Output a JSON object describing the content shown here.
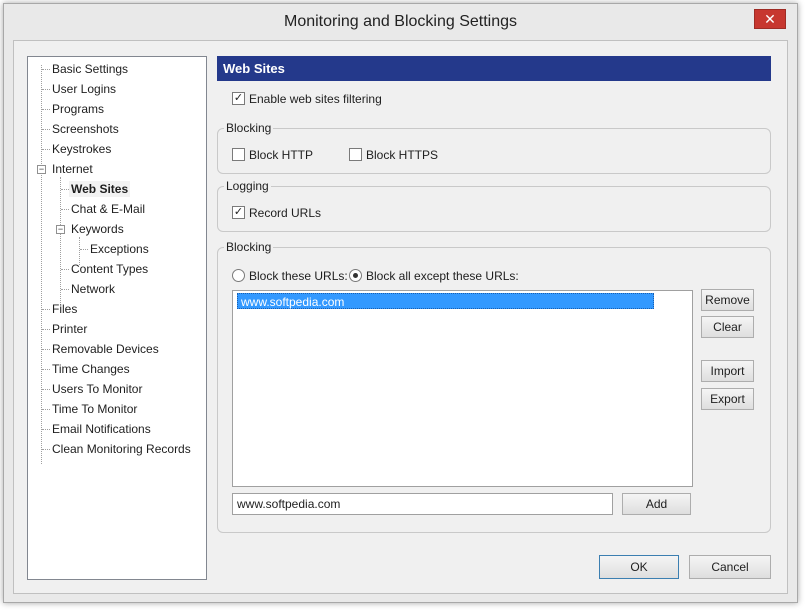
{
  "window": {
    "title": "Monitoring and Blocking Settings",
    "close_glyph": "✕"
  },
  "tree": {
    "items": [
      "Basic Settings",
      "User Logins",
      "Programs",
      "Screenshots",
      "Keystrokes",
      "Internet",
      "Web Sites",
      "Chat & E-Mail",
      "Keywords",
      "Exceptions",
      "Content Types",
      "Network",
      "Files",
      "Printer",
      "Removable Devices",
      "Time Changes",
      "Users To Monitor",
      "Time To Monitor",
      "Email Notifications",
      "Clean Monitoring Records"
    ],
    "selected": "Web Sites",
    "expander_glyph": "−"
  },
  "panel": {
    "header": "Web Sites",
    "enable_filtering": {
      "label": "Enable web sites filtering",
      "checked": true
    },
    "blocking_group": {
      "title": "Blocking",
      "block_http": {
        "label": "Block HTTP",
        "checked": false
      },
      "block_https": {
        "label": "Block HTTPS",
        "checked": false
      }
    },
    "logging_group": {
      "title": "Logging",
      "record_urls": {
        "label": "Record URLs",
        "checked": true
      }
    },
    "url_group": {
      "title": "Blocking",
      "radio_block_these": {
        "label": "Block these URLs:",
        "selected": false
      },
      "radio_block_except": {
        "label": "Block all except these URLs:",
        "selected": true
      },
      "urls": [
        "www.softpedia.com"
      ],
      "remove_label": "Remove",
      "clear_label": "Clear",
      "import_label": "Import",
      "export_label": "Export",
      "input_value": "www.softpedia.com",
      "add_label": "Add"
    }
  },
  "footer": {
    "ok_label": "OK",
    "cancel_label": "Cancel"
  },
  "colors": {
    "header_bg": "#24398b",
    "selection": "#3399ff",
    "close_bg": "#c7372f"
  }
}
